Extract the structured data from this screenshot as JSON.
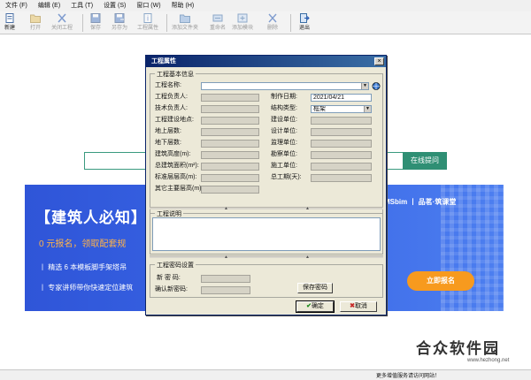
{
  "menu": [
    "文件 (F)",
    "编辑 (E)",
    "工具 (T)",
    "设置 (S)",
    "窗口 (W)",
    "帮助 (H)"
  ],
  "toolbar": {
    "new": "新建",
    "open": "打开",
    "close": "关闭工程",
    "save": "保存",
    "save_as": "另存为",
    "props": "工程属性",
    "add_folder": "添加文件夹",
    "rename": "重命名",
    "add_module": "添加模块",
    "delete": "删除",
    "exit": "退出"
  },
  "background": {
    "ask_button": "在线提问",
    "banner_title": "【建筑人必知】",
    "banner_sub": "0 元报名，领取配套规",
    "banner_line1": "丨 精选 6 本模板脚手架塔吊",
    "banner_line2": "丨 专家讲师带你快速定位建筑",
    "banner_brand": "MSbim 丨 品茗·筑课堂",
    "banner_cta": "立即报名"
  },
  "status_text": "更多增值服务请访问网站！",
  "watermark": {
    "title": "合众软件园",
    "url": "www.hezhong.net"
  },
  "dialog": {
    "title": "工程属性",
    "close": "×",
    "basic_group": "工程基本信息",
    "name_label": "工程名称:",
    "name_value": "",
    "left_labels": [
      "工程负责人:",
      "技术负责人:",
      "工程建设地点:",
      "地上层数:",
      "地下层数:",
      "建筑高度(m):",
      "总建筑面积(m²):",
      "标准层层高(m):",
      "其它主要层高(m):"
    ],
    "right_labels": [
      "制作日期:",
      "结构类型:",
      "建设单位:",
      "设计单位:",
      "监理单位:",
      "勘察单位:",
      "施工单位:",
      "总工期(天):"
    ],
    "date_value": "2021/04/21",
    "structure_value": "框架",
    "desc_group": "工程说明",
    "pwd_group": "工程密码设置",
    "new_pwd": "新 密 码:",
    "confirm_pwd": "确认新密码:",
    "save_pwd": "保存密码",
    "ok": "确定",
    "cancel": "取消"
  },
  "colors": {
    "titlebar": "#0a246a",
    "banner": "#3a67e6",
    "cta": "#f79a1e",
    "accent": "#2f8f74"
  }
}
